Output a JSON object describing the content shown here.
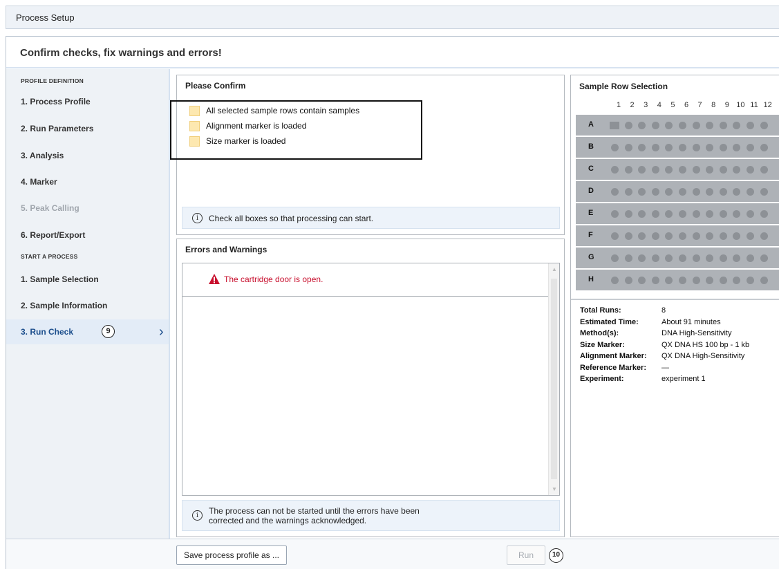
{
  "window": {
    "title": "Process Setup"
  },
  "header": {
    "title": "Confirm checks, fix warnings and errors!"
  },
  "sidebar": {
    "profile_section": "PROFILE DEFINITION",
    "profile_items": [
      {
        "label": "1. Process Profile"
      },
      {
        "label": "2. Run Parameters"
      },
      {
        "label": "3. Analysis"
      },
      {
        "label": "4. Marker"
      },
      {
        "label": "5. Peak Calling",
        "disabled": true
      },
      {
        "label": "6. Report/Export"
      }
    ],
    "process_section": "START A PROCESS",
    "process_items": [
      {
        "label": "1. Sample Selection"
      },
      {
        "label": "2. Sample Information"
      },
      {
        "label": "3. Run Check",
        "active": true,
        "callout": "9"
      }
    ]
  },
  "confirm": {
    "title": "Please Confirm",
    "checks": [
      {
        "label": "All selected sample rows contain samples",
        "checked": false
      },
      {
        "label": "Alignment marker is loaded",
        "checked": false
      },
      {
        "label": "Size marker is loaded",
        "checked": false
      }
    ],
    "info": "Check all boxes so that processing can start."
  },
  "errors": {
    "title": "Errors and Warnings",
    "items": [
      {
        "severity": "error",
        "text": "The cartridge door is open."
      }
    ],
    "info_line1": "The process can not be started until the errors have been",
    "info_line2": "corrected and the warnings acknowledged."
  },
  "sample_rows": {
    "title": "Sample Row Selection",
    "columns": [
      "1",
      "2",
      "3",
      "4",
      "5",
      "6",
      "7",
      "8",
      "9",
      "10",
      "11",
      "12"
    ],
    "rows": [
      "A",
      "B",
      "C",
      "D",
      "E",
      "F",
      "G",
      "H"
    ],
    "summary": [
      {
        "key": "Total Runs:",
        "value": "8"
      },
      {
        "key": "Estimated Time:",
        "value": "About 91 minutes"
      },
      {
        "key": "Method(s):",
        "value": "DNA High-Sensitivity"
      },
      {
        "key": "Size Marker:",
        "value": "QX DNA HS 100 bp - 1 kb"
      },
      {
        "key": "Alignment Marker:",
        "value": "QX DNA High-Sensitivity"
      },
      {
        "key": "Reference Marker:",
        "value": "—"
      },
      {
        "key": "Experiment:",
        "value": "experiment 1"
      }
    ]
  },
  "footer": {
    "save_label": "Save process profile as ...",
    "run_label": "Run",
    "run_callout": "10"
  },
  "colors": {
    "accent": "#1c4e8c",
    "error": "#c8102e",
    "checkbox": "#fde8b0",
    "plate_row": "#aeb2b7"
  }
}
